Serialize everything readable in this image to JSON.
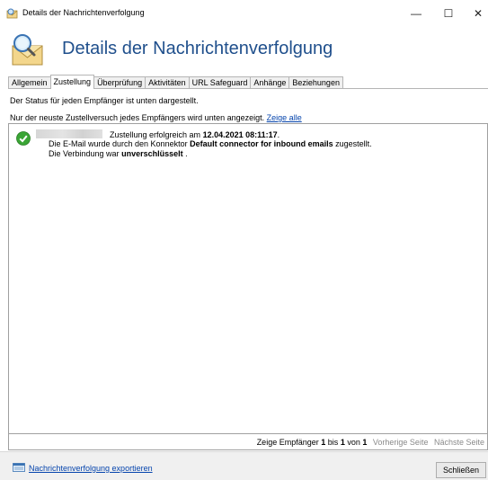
{
  "window": {
    "title": "Details der Nachrichtenverfolgung",
    "minimize_glyph": "—",
    "maximize_glyph": "☐",
    "close_glyph": "✕"
  },
  "header": {
    "heading": "Details der Nachrichtenverfolgung",
    "icon": "envelope-magnifier-icon"
  },
  "tabs": [
    {
      "label": "Allgemein",
      "active": false
    },
    {
      "label": "Zustellung",
      "active": true
    },
    {
      "label": "Überprüfung",
      "active": false
    },
    {
      "label": "Aktivitäten",
      "active": false
    },
    {
      "label": "URL Safeguard",
      "active": false
    },
    {
      "label": "Anhänge",
      "active": false
    },
    {
      "label": "Beziehungen",
      "active": false
    }
  ],
  "info": {
    "status_text": "Der Status für jeden Empfänger ist unten dargestellt.",
    "latest_text": "Nur der neuste Zustellversuch jedes Empfängers wird unten angezeigt.",
    "show_all_link": "Zeige alle"
  },
  "entry": {
    "status_icon": "check-circle-icon",
    "line1_prefix": "Zustellung erfolgreich am",
    "line1_datetime": "12.04.2021 08:11:17",
    "line1_suffix": ".",
    "line2_prefix": "Die E-Mail wurde  durch den Konnektor",
    "line2_connector": "Default connector for inbound emails",
    "line2_suffix": " zugestellt.",
    "line3_prefix": "Die Verbindung war",
    "line3_value": "unverschlüsselt",
    "line3_suffix": " ."
  },
  "pager": {
    "prefix": "Zeige Empfänger",
    "from": "1",
    "bis": "bis",
    "to": "1",
    "von": "von",
    "total": "1",
    "prev": "Vorherige Seite",
    "next": "Nächste Seite"
  },
  "footer": {
    "export_link": "Nachrichtenverfolgung exportieren",
    "close_button": "Schließen"
  },
  "colors": {
    "heading": "#1f4f8c",
    "link": "#0645ad",
    "success": "#3aa535"
  }
}
